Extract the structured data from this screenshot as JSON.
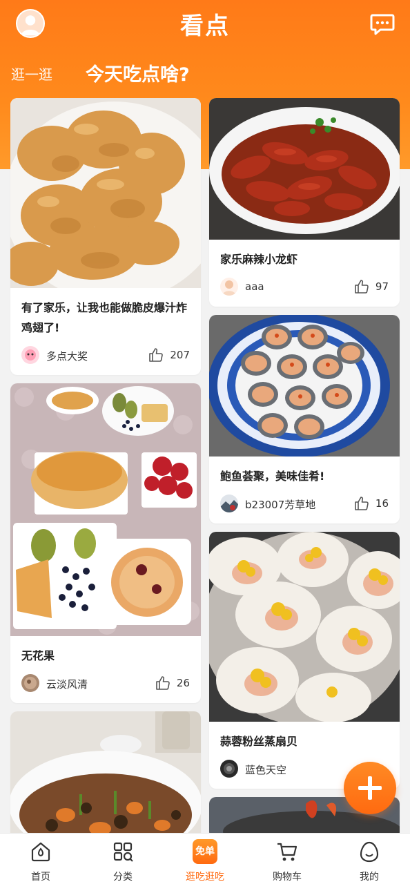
{
  "header": {
    "logo_text": "看点",
    "avatar_icon": "user-avatar-icon",
    "message_icon": "message-icon"
  },
  "tabs": {
    "inactive": "逛一逛",
    "active": "今天吃点啥?"
  },
  "feed": {
    "left": [
      {
        "title": "有了家乐，让我也能做脆皮爆汁炸鸡翅了!",
        "author": "多点大奖",
        "likes": "207"
      },
      {
        "title": "无花果",
        "author": "云淡风清",
        "likes": "26"
      }
    ],
    "right": [
      {
        "title": "家乐麻辣小龙虾",
        "author": "aaa",
        "likes": "97"
      },
      {
        "title": "鲍鱼荟聚，美味佳肴!",
        "author": "b23007芳草地",
        "likes": "16"
      },
      {
        "title": "蒜蓉粉丝蒸扇贝",
        "author": "蓝色天空",
        "likes": ""
      }
    ]
  },
  "fab": {
    "icon": "plus-icon"
  },
  "bottom_nav": [
    {
      "label": "首页",
      "icon": "home-icon"
    },
    {
      "label": "分类",
      "icon": "category-grid-icon"
    },
    {
      "label": "逛吃逛吃",
      "badge": "免单",
      "icon": "free-bag-icon"
    },
    {
      "label": "购物车",
      "icon": "cart-icon"
    },
    {
      "label": "我的",
      "icon": "egg-profile-icon"
    }
  ],
  "colors": {
    "brand_orange": "#ff7a18",
    "active_nav": "#ff6a10"
  }
}
